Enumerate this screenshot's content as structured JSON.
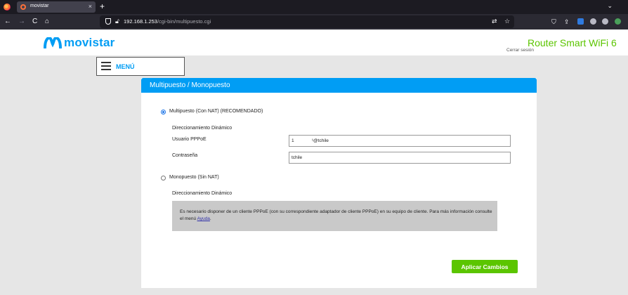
{
  "browser": {
    "tab_title": "movistar",
    "tab_close": "×",
    "new_tab": "+",
    "tab_list": "⌄",
    "url_host": "192.168.1.253",
    "url_path": "/cgi-bin/multipuesto.cgi",
    "nav": {
      "back": "←",
      "forward": "→",
      "reload": "C",
      "home": "⌂"
    }
  },
  "header": {
    "logo_text": "movistar",
    "product_name": "Router Smart WiFi 6",
    "logout": "Cerrar sesión",
    "brand_color": "#019df4",
    "accent_color": "#5bc500"
  },
  "menu": {
    "label": "MENÚ"
  },
  "panel": {
    "title": "Multipuesto / Monopuesto",
    "options": [
      {
        "label": "Multipuesto (Con NAT) (RECOMENDADO)",
        "selected": true,
        "section": "Direccionamiento Dinámico",
        "fields": [
          {
            "label": "Usuario PPPoE",
            "value": "1              ¹@tchile"
          },
          {
            "label": "Contraseña",
            "value": "tchile"
          }
        ]
      },
      {
        "label": "Monopuesto (Sin NAT)",
        "selected": false,
        "section": "Direccionamiento Dinámico",
        "info": "Es necesario disponer de un cliente PPPoE (con su correspondiente adaptador de cliente PPPoE) en su equipo de cliente. Para más información consulte el menú ",
        "info_link": "Ayuda",
        "info_end": "."
      }
    ],
    "apply_button": "Aplicar Cambios"
  }
}
